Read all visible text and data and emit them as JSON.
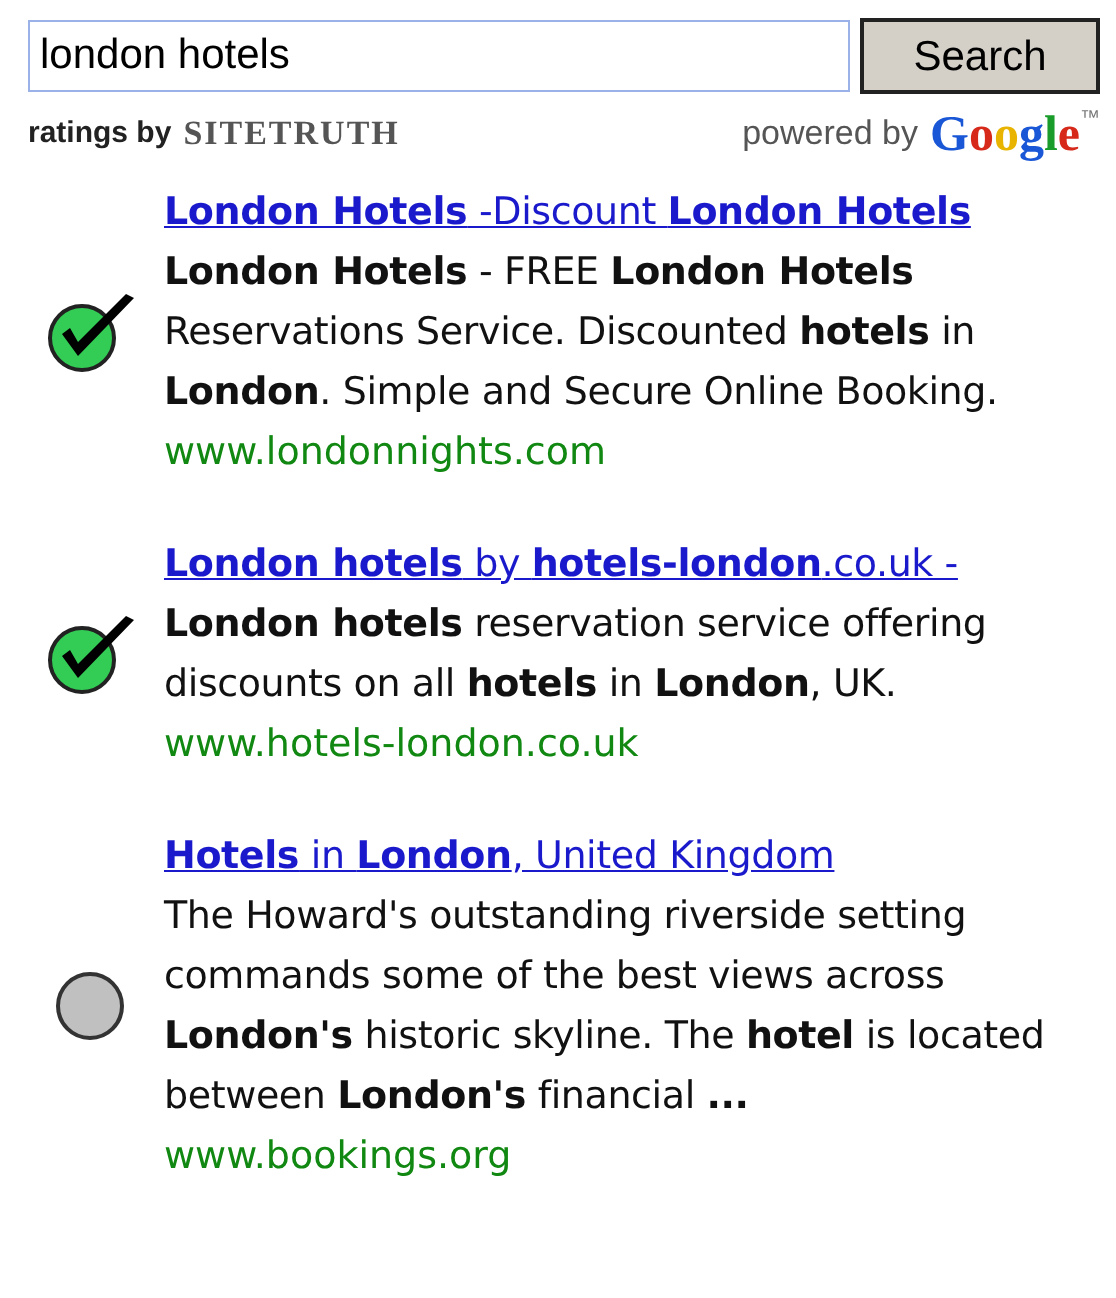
{
  "search": {
    "value": "london hotels",
    "button": "Search"
  },
  "ratings_by": {
    "label": "ratings by",
    "brand": "SITETRUTH"
  },
  "powered_by": {
    "label": "powered by",
    "brand": "Google",
    "trademark": "™"
  },
  "results": [
    {
      "kind": "verified",
      "title": "**London Hotels** -Discount **London Hotels**",
      "snippet": "**London Hotels** - FREE **London Hotels** Reservations Service. Discounted **hotels** in **London**. Simple and Secure Online Booking.",
      "url": "www.londonnights.com"
    },
    {
      "kind": "verified",
      "title": "**London hotels** by **hotels-london**.co.uk -",
      "snippet": "**London hotels** reservation service offering discounts on all **hotels** in **London**, UK.",
      "url": "www.hotels-london.co.uk"
    },
    {
      "kind": "unrated",
      "title": "**Hotels** in **London**, United Kingdom",
      "snippet": "The Howard's outstanding riverside setting commands some of the best views across **London's** historic skyline. The **hotel** is located between **London's** financial **...**",
      "url": "www.bookings.org"
    }
  ]
}
